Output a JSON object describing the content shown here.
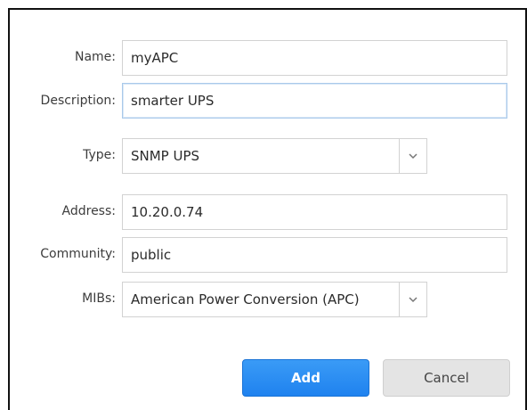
{
  "form": {
    "name": {
      "label": "Name:",
      "value": "myAPC"
    },
    "description": {
      "label": "Description:",
      "value": "smarter UPS"
    },
    "type": {
      "label": "Type:",
      "value": "SNMP UPS",
      "icon": "chevron-down-icon"
    },
    "address": {
      "label": "Address:",
      "value": "10.20.0.74"
    },
    "community": {
      "label": "Community:",
      "value": "public"
    },
    "mibs": {
      "label": "MIBs:",
      "value": "American Power Conversion (APC)",
      "icon": "chevron-down-icon"
    }
  },
  "actions": {
    "add_label": "Add",
    "cancel_label": "Cancel"
  },
  "colors": {
    "primary": "#2a8ef3",
    "secondary": "#e4e4e4",
    "focus_border": "#a9c9ea"
  }
}
